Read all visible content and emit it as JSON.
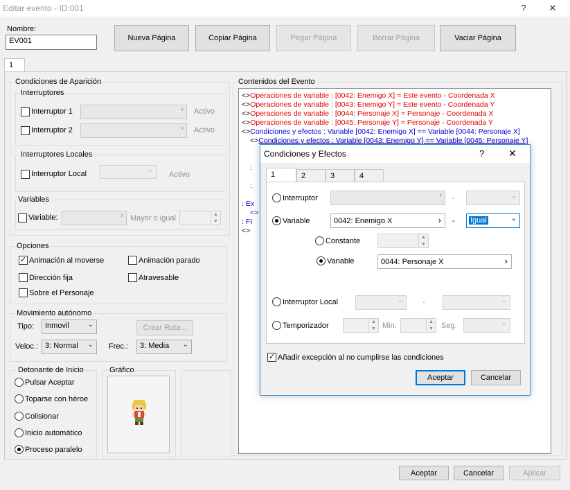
{
  "window": {
    "title": "Editar evento - ID:001",
    "help": "?",
    "close": "✕"
  },
  "header": {
    "name_label": "Nombre:",
    "name_value": "EV001",
    "buttons": {
      "new_page": "Nueva Página",
      "copy_page": "Copiar Página",
      "paste_page": "Pegar Página",
      "delete_page": "Borrar Página",
      "clear_page": "Vaciar Página"
    }
  },
  "page_tab": "1",
  "conditions": {
    "title": "Condiciones de Aparición",
    "switches_title": "Interruptores",
    "switch1": "Interruptor 1",
    "switch2": "Interruptor 2",
    "active1": "Activo",
    "active2": "Activo",
    "local_title": "Interruptores Locales",
    "local_switch": "Interruptor Local",
    "local_active": "Activo",
    "variables_title": "Variables",
    "variable": "Variable:",
    "greater_equal": "Mayor o igual"
  },
  "options": {
    "title": "Opciones",
    "walk_anim": "Animación al moverse",
    "step_anim": "Animación parado",
    "dir_fix": "Dirección fija",
    "through": "Atravesable",
    "above_char": "Sobre el Personaje",
    "walk_anim_checked": true
  },
  "autonomous": {
    "title": "Movimiento autónomo",
    "type_label": "Tipo:",
    "type_value": "Inmovil",
    "create_route": "Crear Ruta...",
    "speed_label": "Veloc.:",
    "speed_value": "3: Normal",
    "freq_label": "Frec.:",
    "freq_value": "3: Media"
  },
  "trigger": {
    "title": "Detonante de Inicio",
    "options": [
      "Pulsar Aceptar",
      "Toparse con héroe",
      "Colisionar",
      "Inicio automático",
      "Proceso paralelo"
    ],
    "selected": "Proceso paralelo"
  },
  "graphic": {
    "title": "Gráfico"
  },
  "contents": {
    "title": "Contenidos del Evento",
    "lines": [
      {
        "prefix": "<>",
        "text": "Operaciones de variable : [0042: Enemigo X] = Este evento - Coordenada X",
        "color": "#e00000",
        "indent": 0
      },
      {
        "prefix": "<>",
        "text": "Operaciones de variable : [0043: Enemigo Y] = Este evento - Coordenada Y",
        "color": "#e00000",
        "indent": 0
      },
      {
        "prefix": "<>",
        "text": "Operaciones de variable : [0044: Personaje X] = Personaje - Coordenada X",
        "color": "#e00000",
        "indent": 0
      },
      {
        "prefix": "<>",
        "text": "Operaciones de variable : [0045: Personaje Y] = Personaje - Coordenada Y",
        "color": "#e00000",
        "indent": 0
      },
      {
        "prefix": "<>",
        "text": "Condiciones y efectos : Variable [0042: Enemigo X] == Variable [0044: Personaje X]",
        "color": "#0000d0",
        "indent": 0
      },
      {
        "prefix": "<>",
        "text": "Condiciones y efectos : Variable [0043: Enemigo Y] == Variable [0045: Personaje Y]",
        "color": "#0000d0",
        "indent": 1
      }
    ],
    "partial": [
      {
        "text": ":",
        "color": "#0000d0"
      },
      {
        "text": ":",
        "color": "#0000d0"
      },
      {
        "text": ": Ex",
        "color": "#0000d0"
      },
      {
        "text": "<>",
        "color": "#0000d0"
      },
      {
        "text": ": FI",
        "color": "#0000d0"
      },
      {
        "text": "<>",
        "color": "#000000"
      }
    ]
  },
  "footer": {
    "ok": "Aceptar",
    "cancel": "Cancelar",
    "apply": "Aplicar"
  },
  "dialog": {
    "title": "Condiciones y Efectos",
    "help": "?",
    "close": "✕",
    "tabs": [
      "1",
      "2",
      "3",
      "4"
    ],
    "switch_label": "Interruptor",
    "dash1": "-",
    "variable_label": "Variable",
    "variable_value": "0042: Enemigo X",
    "dash2": "-",
    "operator": "Igual",
    "constant_label": "Constante",
    "variable2_label": "Variable",
    "variable2_value": "0044: Personaje X",
    "local_label": "Interruptor Local",
    "dash3": "-",
    "timer_label": "Temporizador",
    "min_label": "Min.",
    "sec_label": "Seg.",
    "else_label": "Añadir excepción al no cumplirse las condiciones",
    "else_checked": true,
    "ok": "Aceptar",
    "cancel": "Cancelar"
  },
  "colors": {
    "accent": "#0078d7",
    "red_text": "#e00000",
    "blue_text": "#0000d0"
  }
}
